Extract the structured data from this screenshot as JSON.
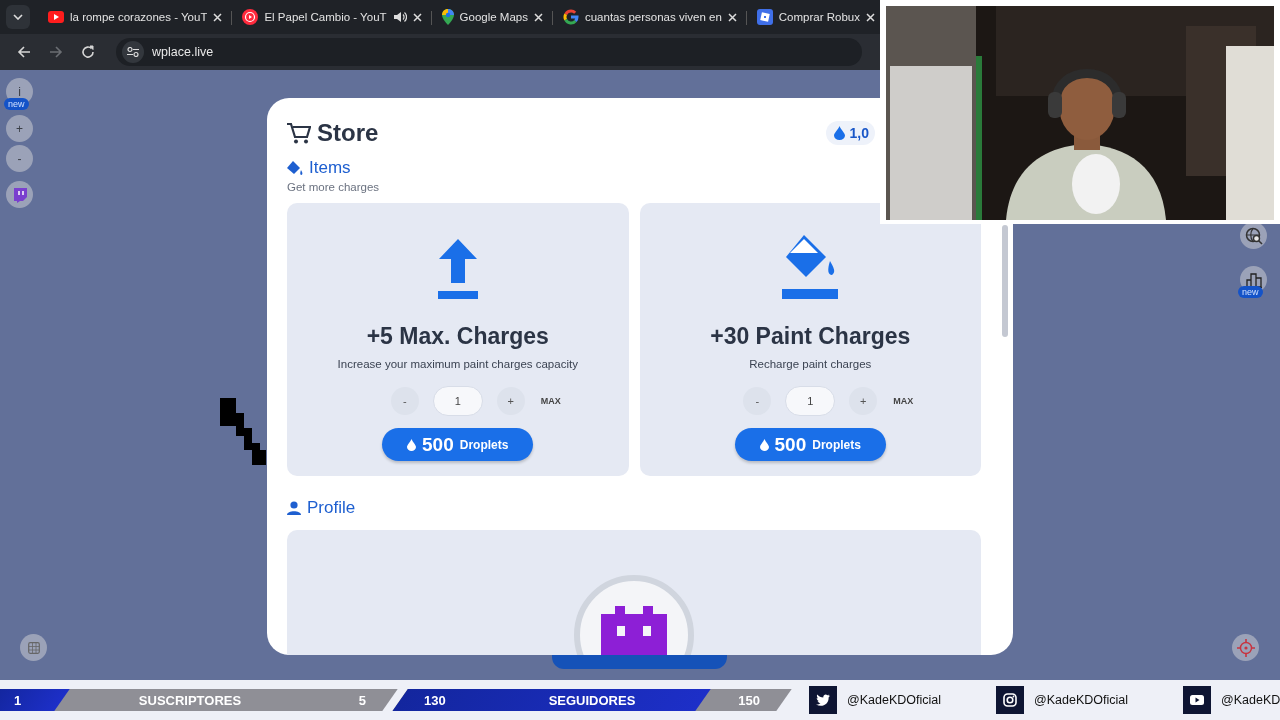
{
  "browser": {
    "tabs": [
      {
        "kind": "youtube",
        "title": "la rompe corazones - YouT",
        "playing_audio": false
      },
      {
        "kind": "music",
        "title": "El Papel Cambio - YouT",
        "playing_audio": true
      },
      {
        "kind": "maps",
        "title": "Google Maps",
        "playing_audio": false
      },
      {
        "kind": "google",
        "title": "cuantas personas viven en",
        "playing_audio": false
      },
      {
        "kind": "roblox",
        "title": "Comprar Robux",
        "playing_audio": false
      }
    ],
    "nav": [
      {
        "kind": "back",
        "disabled": false
      },
      {
        "kind": "forward",
        "disabled": true
      },
      {
        "kind": "reload",
        "disabled": false
      }
    ],
    "address": "wplace.live"
  },
  "map_controls": {
    "left": [
      {
        "kind": "info",
        "label": "i",
        "badge": "new"
      },
      {
        "kind": "zoom_in",
        "label": "+"
      },
      {
        "kind": "zoom_out",
        "label": "-"
      },
      {
        "kind": "twitch"
      }
    ],
    "right": [
      {
        "kind": "search"
      },
      {
        "kind": "leaderboard",
        "badge": "new"
      }
    ],
    "bottom": [
      {
        "kind": "square"
      },
      {
        "kind": "locate"
      }
    ]
  },
  "store": {
    "title": "Store",
    "balance": "1,0",
    "items_heading": "Items",
    "items_subtitle": "Get more charges",
    "items": [
      {
        "kind": "upgrade",
        "title": "+5 Max. Charges",
        "description": "Increase your maximum paint charges capacity",
        "minus": "-",
        "quantity": "1",
        "plus": "+",
        "max": "MAX",
        "price": "500",
        "currency": "Droplets"
      },
      {
        "kind": "paint",
        "title": "+30 Paint Charges",
        "description": "Recharge paint charges",
        "minus": "-",
        "quantity": "1",
        "plus": "+",
        "max": "MAX",
        "price": "500",
        "currency": "Droplets"
      }
    ],
    "profile_heading": "Profile"
  },
  "stream_bar": {
    "goals": [
      {
        "start": "1",
        "label": "SUSCRIPTORES",
        "end": "5",
        "level": 0.18
      },
      {
        "start": "130",
        "label": "SEGUIDORES",
        "end": "150",
        "level": 0.79
      }
    ],
    "socials": [
      {
        "kind": "twitter",
        "handle": "@KadeKDOficial"
      },
      {
        "kind": "instagram",
        "handle": "@KadeKDOficial"
      },
      {
        "kind": "youtube",
        "handle": "@KadeKD"
      }
    ]
  }
}
